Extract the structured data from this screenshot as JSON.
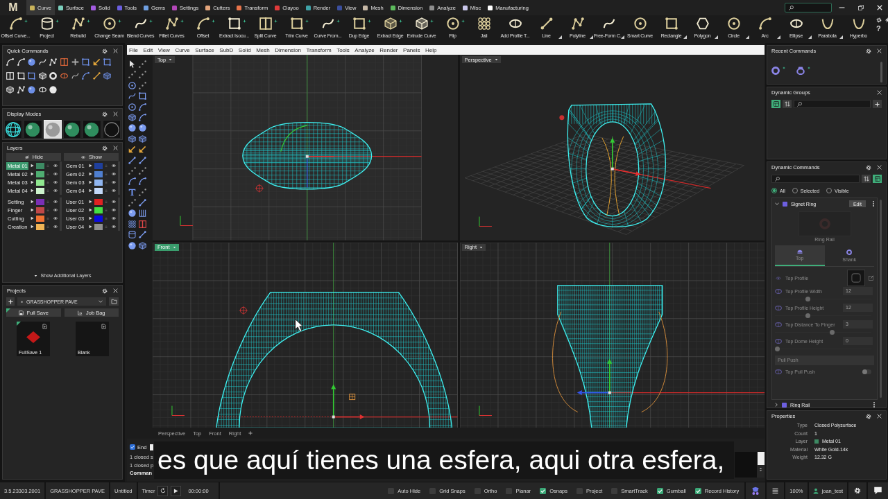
{
  "app": {
    "logo": "M",
    "help": "?"
  },
  "ribbon_tabs": [
    {
      "label": "Curve",
      "color": "#c9b35a",
      "selected": true
    },
    {
      "label": "Surface",
      "color": "#7ccfbd",
      "selected": false
    },
    {
      "label": "Solid",
      "color": "#a35be0",
      "selected": false
    },
    {
      "label": "Tools",
      "color": "#6b5fe0",
      "selected": false
    },
    {
      "label": "Gems",
      "color": "#6f9fe0",
      "selected": false
    },
    {
      "label": "Settings",
      "color": "#b347b8",
      "selected": false
    },
    {
      "label": "Cutters",
      "color": "#e3a57c",
      "selected": false
    },
    {
      "label": "Transform",
      "color": "#e8744a",
      "selected": false
    },
    {
      "label": "Clayoo",
      "color": "#e03a3a",
      "selected": false
    },
    {
      "label": "Render",
      "color": "#3fa3a8",
      "selected": false
    },
    {
      "label": "View",
      "color": "#3b4f9e",
      "selected": false
    },
    {
      "label": "Mesh",
      "color": "#c6b8a6",
      "selected": false
    },
    {
      "label": "Dimension",
      "color": "#5cba5c",
      "selected": false
    },
    {
      "label": "Analyze",
      "color": "#8f8f8f",
      "selected": false
    },
    {
      "label": "Misc",
      "color": "#c9c6ea",
      "selected": false
    },
    {
      "label": "Manufacturing",
      "color": "#ffffff",
      "selected": false
    }
  ],
  "toolbar": [
    {
      "label": "Offset Curve...",
      "kind": "sparkle"
    },
    {
      "label": "Project",
      "kind": "sparkle"
    },
    {
      "label": "Rebuild",
      "kind": "sparkle"
    },
    {
      "label": "Change Seam",
      "kind": "sparkle"
    },
    {
      "label": "Blend Curves",
      "kind": "sparkle"
    },
    {
      "label": "Fillet Curves",
      "kind": "sparkle"
    },
    {
      "label": "Offset",
      "kind": "sparkle"
    },
    {
      "label": "Extract Isocu...",
      "kind": "sparkle"
    },
    {
      "label": "Split Curve",
      "kind": "sparkle"
    },
    {
      "label": "Trim Curve",
      "kind": "sparkle"
    },
    {
      "label": "Curve From...",
      "kind": "sparkle"
    },
    {
      "label": "Dup Edge",
      "kind": "sparkle"
    },
    {
      "label": "Extract Edge",
      "kind": "sparkle"
    },
    {
      "label": "Extrude Curve",
      "kind": "sparkle"
    },
    {
      "label": "Flip",
      "kind": "sparkle"
    },
    {
      "label": "Jali",
      "kind": "plain"
    },
    {
      "label": "Add Profile T...",
      "kind": "plain"
    },
    {
      "label": "Line",
      "kind": "flyout"
    },
    {
      "label": "Polyline",
      "kind": "flyout"
    },
    {
      "label": "Free-Form C...",
      "kind": "flyout"
    },
    {
      "label": "Smart Curve",
      "kind": "plain"
    },
    {
      "label": "Rectangle",
      "kind": "flyout"
    },
    {
      "label": "Polygon",
      "kind": "flyout"
    },
    {
      "label": "Circle",
      "kind": "flyout"
    },
    {
      "label": "Arc",
      "kind": "flyout"
    },
    {
      "label": "Ellipse",
      "kind": "flyout"
    },
    {
      "label": "Parabola",
      "kind": "flyout"
    },
    {
      "label": "Hyperbo",
      "kind": "plain"
    }
  ],
  "menu_bar": [
    "File",
    "Edit",
    "View",
    "Curve",
    "Surface",
    "SubD",
    "Solid",
    "Mesh",
    "Dimension",
    "Transform",
    "Tools",
    "Analyze",
    "Render",
    "Panels",
    "Help"
  ],
  "quick_commands": {
    "title": "Quick Commands"
  },
  "display_modes": {
    "title": "Display Modes",
    "modes": [
      {
        "kind": "wireframe",
        "selected": false
      },
      {
        "kind": "shaded",
        "selected": false
      },
      {
        "kind": "metal",
        "selected": true
      },
      {
        "kind": "shaded",
        "selected": false
      },
      {
        "kind": "shaded",
        "selected": false
      },
      {
        "kind": "outline",
        "selected": false
      }
    ]
  },
  "layers": {
    "title": "Layers",
    "hide_button": "Hide",
    "show_button": "Show",
    "blocks": [
      {
        "left": [
          {
            "name": "Metal 01",
            "color": "#3d8a63",
            "selected": true
          },
          {
            "name": "Metal 02",
            "color": "#4fae72",
            "selected": false
          },
          {
            "name": "Metal 03",
            "color": "#8fe88f",
            "selected": false
          },
          {
            "name": "Metal 04",
            "color": "#cdf3cd",
            "selected": false
          }
        ],
        "right": [
          {
            "name": "Gem 01",
            "color": "#1f3f9c",
            "selected": false
          },
          {
            "name": "Gem 02",
            "color": "#4f7fd0",
            "selected": false
          },
          {
            "name": "Gem 03",
            "color": "#8fb5f0",
            "selected": false
          },
          {
            "name": "Gem 04",
            "color": "#c3d8f8",
            "selected": false
          }
        ]
      },
      {
        "left": [
          {
            "name": "Setting",
            "color": "#7a2fb5",
            "selected": false
          },
          {
            "name": "Finger",
            "color": "#c04848",
            "selected": false
          },
          {
            "name": "Cutting",
            "color": "#f07232",
            "selected": false
          },
          {
            "name": "Creation",
            "color": "#f0b455",
            "selected": false
          }
        ],
        "right": [
          {
            "name": "User 01",
            "color": "#e02222",
            "selected": false
          },
          {
            "name": "User 02",
            "color": "#44e044",
            "selected": false
          },
          {
            "name": "User 03",
            "color": "#0a0ae0",
            "selected": false
          },
          {
            "name": "User 04",
            "color": "#8e8e8e",
            "selected": false
          }
        ]
      }
    ],
    "more": "Show Additional Layers"
  },
  "projects": {
    "title": "Projects",
    "project": "GRASSHOPPER PAVE",
    "buttons": [
      {
        "label": "Full Save",
        "kind": "save",
        "selected": true
      },
      {
        "label": "Job Bag",
        "kind": "bag",
        "selected": false
      }
    ],
    "saves": [
      {
        "label": "FullSave 1",
        "kind": "model",
        "selected": true
      },
      {
        "label": "Blank",
        "kind": "blank",
        "selected": false
      }
    ]
  },
  "viewports": {
    "views": [
      {
        "label": "Top",
        "kind": "top",
        "selected": false
      },
      {
        "label": "Perspective",
        "kind": "perspective",
        "selected": false
      },
      {
        "label": "Front",
        "kind": "front",
        "selected": true
      },
      {
        "label": "Right",
        "kind": "right",
        "selected": false
      }
    ],
    "tabs": [
      "Perspective",
      "Top",
      "Front",
      "Right"
    ]
  },
  "command": {
    "end": {
      "label": "End",
      "checked": true
    },
    "history": [
      "1 closed s",
      "1 closed p"
    ],
    "prompt": "Comman"
  },
  "caption": "es que aquí tienes una esfera, aqui otra esfera,",
  "recent_commands": {
    "title": "Recent Commands"
  },
  "dynamic_groups": {
    "title": "Dynamic Groups"
  },
  "dynamic_commands": {
    "title": "Dynamic Commands",
    "filters": [
      {
        "label": "All",
        "selected": true
      },
      {
        "label": "Selected",
        "selected": false
      },
      {
        "label": "Visible",
        "selected": false
      }
    ],
    "groups": [
      {
        "name": "Signet Ring",
        "expanded": true,
        "edit": "Edit",
        "preview": "Ring Rail",
        "tabs": [
          {
            "label": "Top",
            "selected": true
          },
          {
            "label": "Shank",
            "selected": false
          }
        ],
        "params": [
          {
            "kind": "profile",
            "label": "Top Profile"
          },
          {
            "kind": "number",
            "label": "Top Profile Width",
            "value": "12",
            "level": 0.33
          },
          {
            "kind": "number",
            "label": "Top Profile Height",
            "value": "12",
            "level": 0.33
          },
          {
            "kind": "number",
            "label": "Top Distance To Finger",
            "value": "3",
            "level": 0.6
          },
          {
            "kind": "number",
            "label": "Top Dome Height",
            "value": "0",
            "level": 0
          },
          {
            "kind": "section",
            "label": "Pull Push"
          },
          {
            "kind": "toggle",
            "label": "Top Pull Push",
            "on": false
          }
        ]
      },
      {
        "name": "Ring Rail",
        "expanded": false
      }
    ]
  },
  "properties": {
    "title": "Properties",
    "rows": [
      {
        "label": "Type",
        "value": "Closed Polysurface"
      },
      {
        "label": "Count",
        "value": "1"
      },
      {
        "label": "Layer",
        "value": "Metal 01",
        "color": "#3d8a63"
      },
      {
        "label": "Material",
        "value": "White Gold-14k"
      },
      {
        "label": "Weight",
        "value": "12.32 G"
      }
    ]
  },
  "status_bar": {
    "version": "3.5.23303.2001",
    "project": "GRASSHOPPER PAVE",
    "file": "Untitled",
    "timer": "Timer",
    "time": "00:00:00",
    "toggles": [
      {
        "label": "Auto Hide",
        "checked": false
      },
      {
        "label": "Grid Snaps",
        "checked": false
      },
      {
        "label": "Ortho",
        "checked": false
      },
      {
        "label": "Planar",
        "checked": false
      },
      {
        "label": "Osnaps",
        "checked": true
      },
      {
        "label": "Project",
        "checked": false
      },
      {
        "label": "SmartTrack",
        "checked": false
      },
      {
        "label": "Gumball",
        "checked": true
      },
      {
        "label": "Record History",
        "checked": true
      }
    ],
    "zoom": "100%",
    "user": "joan_test"
  }
}
